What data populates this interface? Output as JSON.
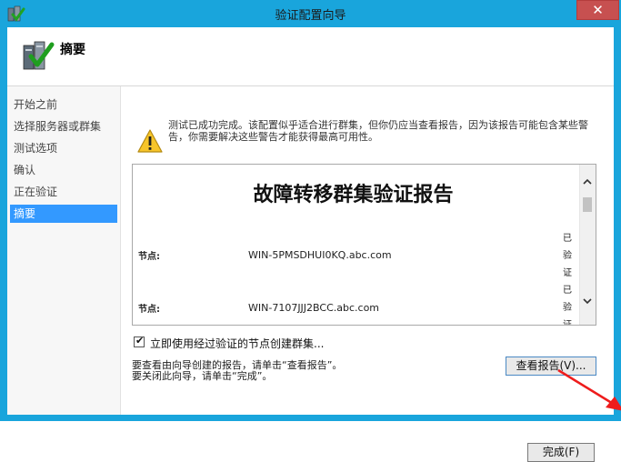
{
  "window": {
    "title": "验证配置向导",
    "close_label": "✕"
  },
  "header": {
    "title": "摘要"
  },
  "steps": [
    "开始之前",
    "选择服务器或群集",
    "测试选项",
    "确认",
    "正在验证",
    "摘要"
  ],
  "active_step": 5,
  "warning": {
    "text": "测试已成功完成。该配置似乎适合进行群集，但你仍应当查看报告，因为该报告可能包含某些警告，你需要解决这些警告才能获得最高可用性。"
  },
  "report": {
    "title": "故障转移群集验证报告",
    "nodes": [
      {
        "label": "节点:",
        "value": "WIN-5PMSDHUI0KQ.abc.com",
        "status_chars": [
          "已",
          "验",
          "证"
        ]
      },
      {
        "label": "节点:",
        "value": "WIN-7107JJJ2BCC.abc.com",
        "status_chars": [
          "已",
          "验",
          "证"
        ]
      }
    ]
  },
  "create_cluster": {
    "label": "立即使用经过验证的节点创建群集...",
    "checked": true,
    "check_glyph": "✔"
  },
  "instructions": {
    "line1": "要查看由向导创建的报告，请单击“查看报告”。",
    "line2": "要关闭此向导，请单击“完成”。"
  },
  "buttons": {
    "view_report": "查看报告(V)...",
    "finish": "完成(F)"
  },
  "colors": {
    "titlebar": "#19a5dc",
    "selection": "#3399ff",
    "close": "#c75050",
    "arrow": "#ee1c1c"
  }
}
